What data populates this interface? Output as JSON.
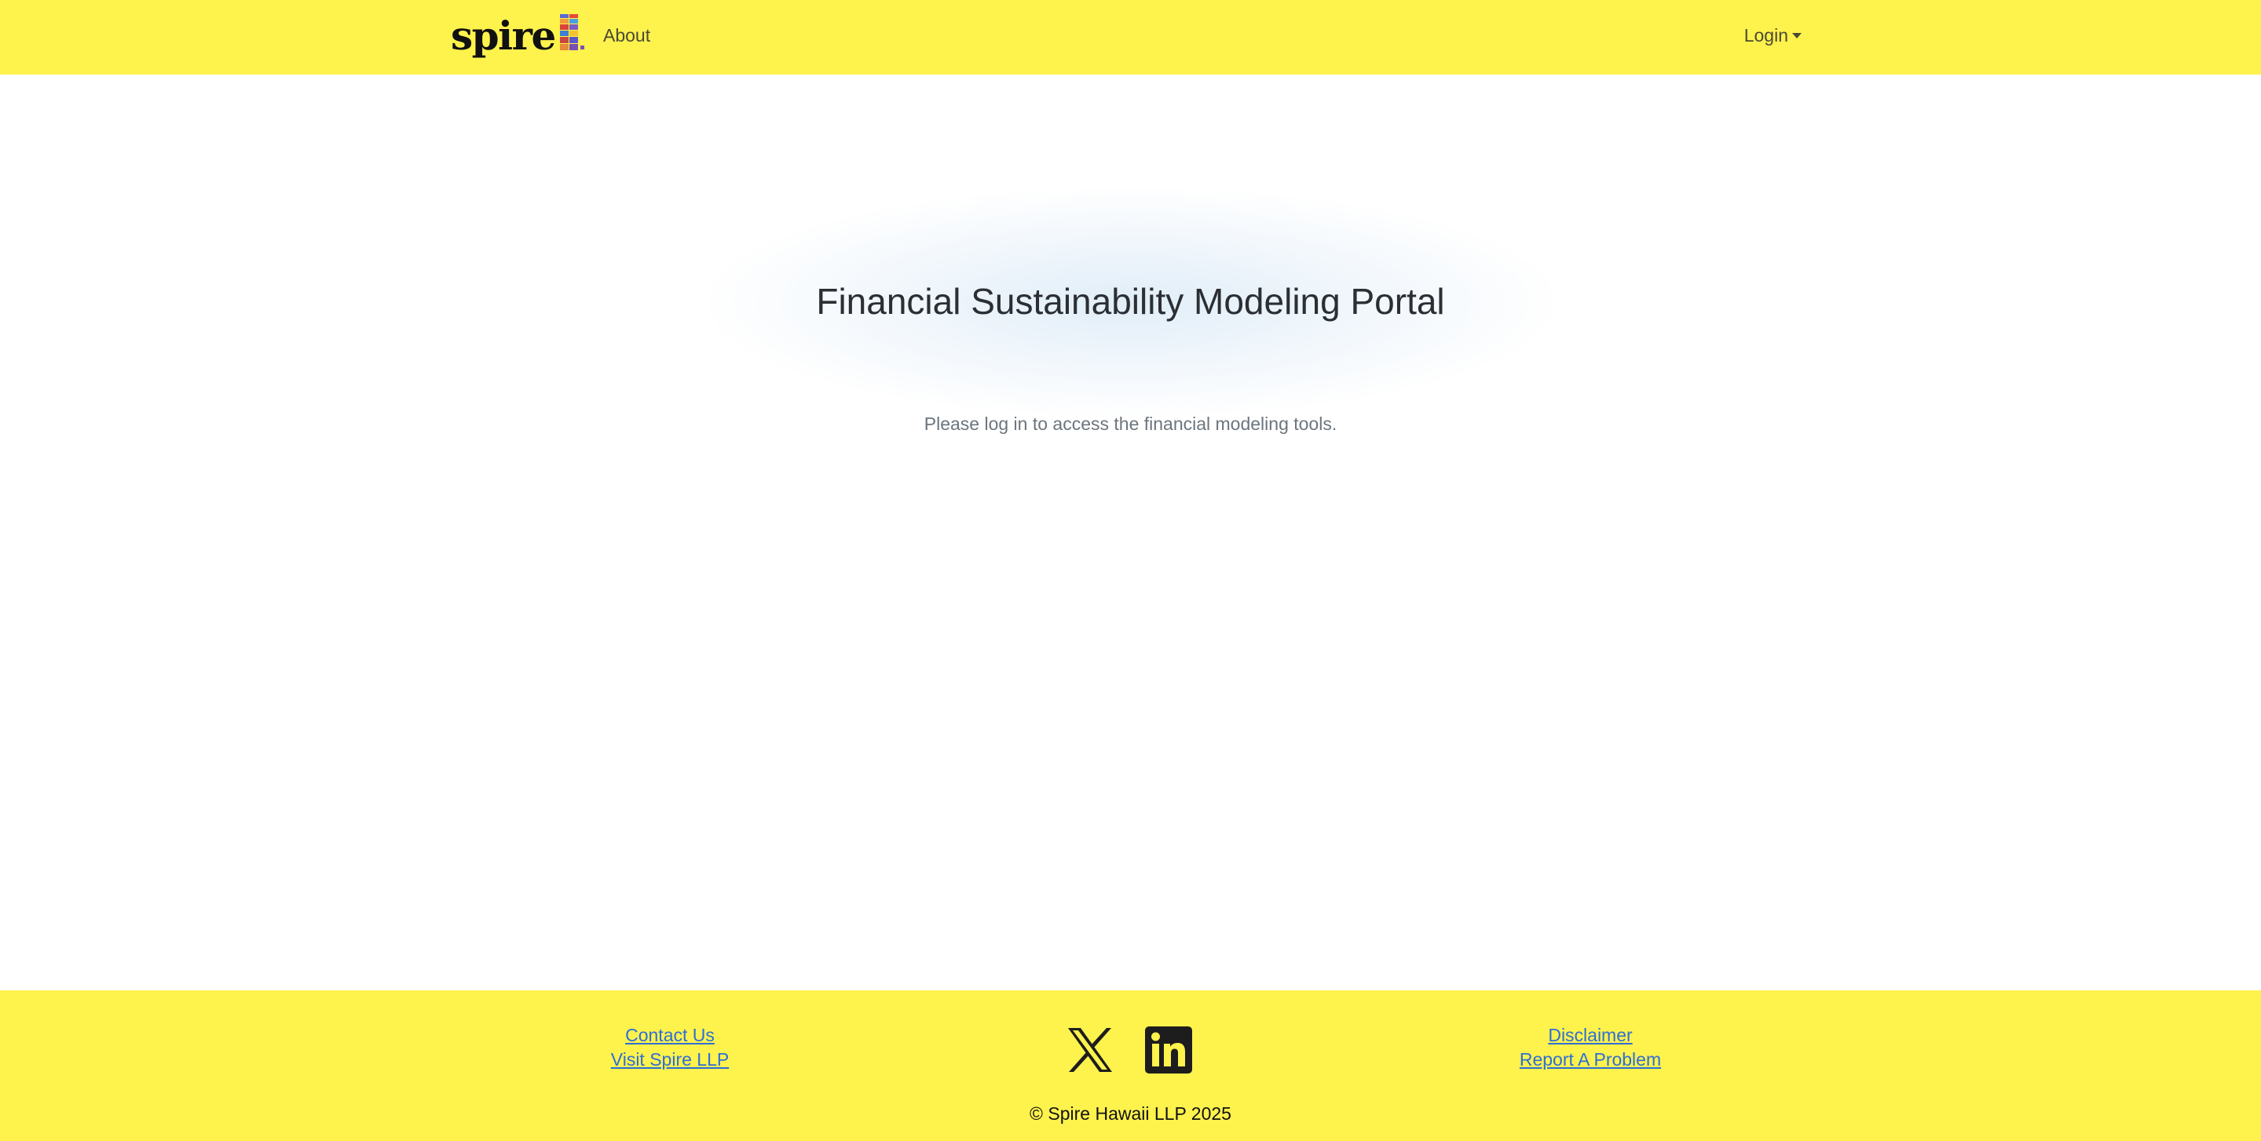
{
  "navbar": {
    "brand": "spire",
    "about": "About",
    "login": "Login",
    "background": "#fef24d"
  },
  "main": {
    "title": "Financial Sustainability Modeling Portal",
    "message": "Please log in to access the financial modeling tools."
  },
  "footer": {
    "contact": "Contact Us",
    "visit": "Visit Spire LLP",
    "disclaimer": "Disclaimer",
    "report": "Report A Problem",
    "social": [
      "x-icon",
      "linkedin-icon"
    ],
    "copyright": "© Spire Hawaii LLP 2025",
    "link_color": "#2d6fd6"
  }
}
